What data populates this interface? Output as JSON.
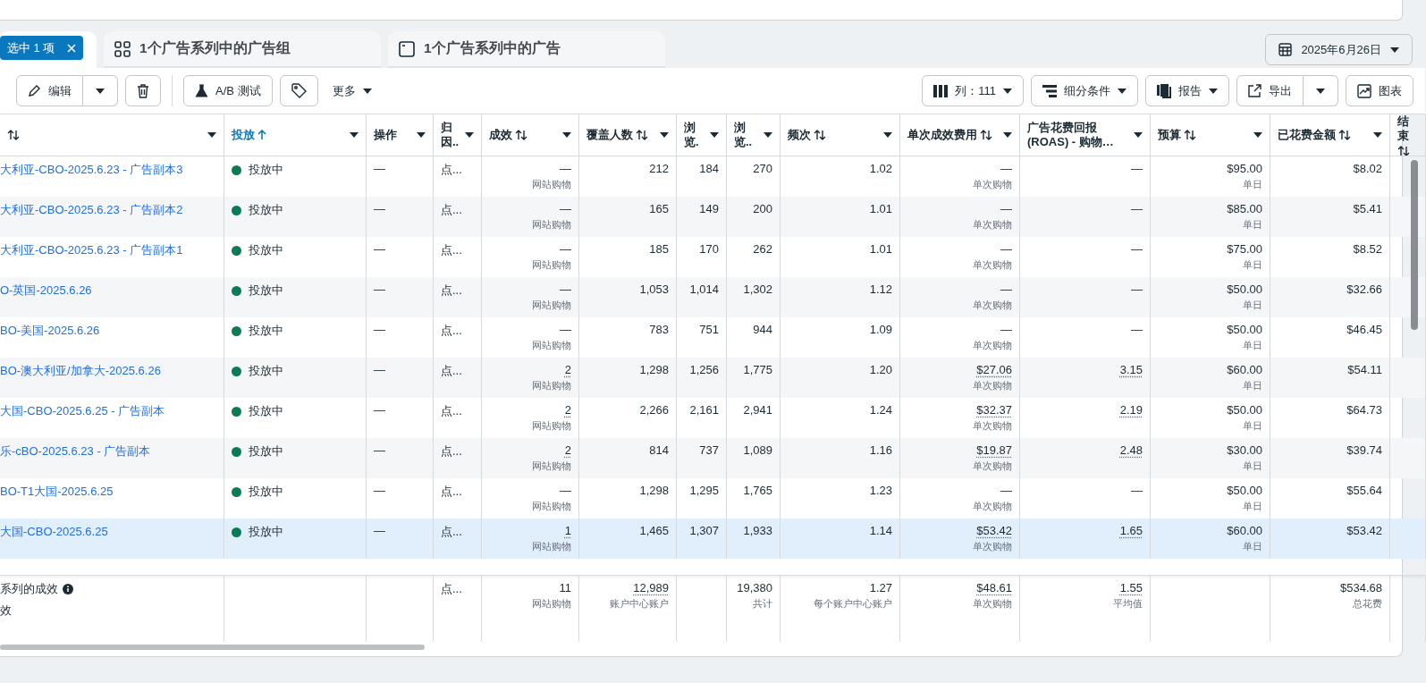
{
  "tabs": [
    {
      "kind": "selection",
      "label": "选中 1 项",
      "selected": true
    },
    {
      "kind": "adsets",
      "label": "1个广告系列中的广告组",
      "selected": false
    },
    {
      "kind": "ads",
      "label": "1个广告系列中的广告",
      "selected": false
    }
  ],
  "date_picker": {
    "label": "2025年6月26日"
  },
  "toolbar": {
    "edit": "编辑",
    "ab_test": "A/B 测试",
    "more": "更多",
    "columns": "列：111",
    "breakdown": "细分条件",
    "reports": "报告",
    "export": "导出",
    "charts": "图表"
  },
  "table": {
    "columns": [
      {
        "sortable": true,
        "selected": false
      },
      {
        "label": "投放",
        "sortable": true,
        "selected": true
      },
      {
        "label": "操作",
        "sortable": false,
        "selected": false
      },
      {
        "label": "归因..",
        "sortable": false,
        "selected": false
      },
      {
        "label": "成效",
        "sortable": true,
        "selected": false
      },
      {
        "label": "覆盖人数",
        "sortable": true,
        "selected": false
      },
      {
        "label": "浏览.",
        "sortable": false,
        "selected": false
      },
      {
        "label": "浏览..",
        "sortable": false,
        "selected": false
      },
      {
        "label": "频次",
        "sortable": true,
        "selected": false
      },
      {
        "label": "单次成效费用",
        "sortable": true,
        "selected": false
      },
      {
        "label": "广告花费回报 (ROAS) - 购物…",
        "sortable": false,
        "selected": false
      },
      {
        "label": "预算",
        "sortable": true,
        "selected": false
      },
      {
        "label": "已花费金额",
        "sortable": true,
        "selected": false
      },
      {
        "label": "结束",
        "sortable": true,
        "selected": false
      }
    ],
    "rows": [
      {
        "selected": false,
        "cells": [
          "大利亚-CBO-2025.6.23 - 广告副本3",
          "投放中",
          "—",
          "点...",
          {
            "text": "—",
            "sub": "网站购物",
            "dotted": false
          },
          "212",
          "184",
          "270",
          "1.02",
          {
            "text": "—",
            "sub": "单次购物",
            "dotted": false
          },
          "—",
          {
            "text": "$95.00",
            "sub": "单日"
          },
          "$8.02"
        ]
      },
      {
        "selected": false,
        "cells": [
          "大利亚-CBO-2025.6.23 - 广告副本2",
          "投放中",
          "—",
          "点...",
          {
            "text": "—",
            "sub": "网站购物",
            "dotted": false
          },
          "165",
          "149",
          "200",
          "1.01",
          {
            "text": "—",
            "sub": "单次购物",
            "dotted": false
          },
          "—",
          {
            "text": "$85.00",
            "sub": "单日"
          },
          "$5.41"
        ]
      },
      {
        "selected": false,
        "cells": [
          "大利亚-CBO-2025.6.23 - 广告副本1",
          "投放中",
          "—",
          "点...",
          {
            "text": "—",
            "sub": "网站购物",
            "dotted": false
          },
          "185",
          "170",
          "262",
          "1.01",
          {
            "text": "—",
            "sub": "单次购物",
            "dotted": false
          },
          "—",
          {
            "text": "$75.00",
            "sub": "单日"
          },
          "$8.52"
        ]
      },
      {
        "selected": false,
        "cells": [
          "O-英国-2025.6.26",
          "投放中",
          "—",
          "点...",
          {
            "text": "—",
            "sub": "网站购物",
            "dotted": false
          },
          "1,053",
          "1,014",
          "1,302",
          "1.12",
          {
            "text": "—",
            "sub": "单次购物",
            "dotted": false
          },
          "—",
          {
            "text": "$50.00",
            "sub": "单日"
          },
          "$32.66"
        ]
      },
      {
        "selected": false,
        "cells": [
          "BO-美国-2025.6.26",
          "投放中",
          "—",
          "点...",
          {
            "text": "—",
            "sub": "网站购物",
            "dotted": false
          },
          "783",
          "751",
          "944",
          "1.09",
          {
            "text": "—",
            "sub": "单次购物",
            "dotted": false
          },
          "—",
          {
            "text": "$50.00",
            "sub": "单日"
          },
          "$46.45"
        ]
      },
      {
        "selected": false,
        "cells": [
          "BO-澳大利亚/加拿大-2025.6.26",
          "投放中",
          "—",
          "点...",
          {
            "text": "2",
            "sub": "网站购物",
            "dotted": true
          },
          "1,298",
          "1,256",
          "1,775",
          "1.20",
          {
            "text": "$27.06",
            "sub": "单次购物",
            "dotted": true
          },
          {
            "text": "3.15",
            "dotted": true
          },
          {
            "text": "$60.00",
            "sub": "单日"
          },
          "$54.11"
        ]
      },
      {
        "selected": false,
        "cells": [
          "大国-CBO-2025.6.25 - 广告副本",
          "投放中",
          "—",
          "点...",
          {
            "text": "2",
            "sub": "网站购物",
            "dotted": true
          },
          "2,266",
          "2,161",
          "2,941",
          "1.24",
          {
            "text": "$32.37",
            "sub": "单次购物",
            "dotted": true
          },
          {
            "text": "2.19",
            "dotted": true
          },
          {
            "text": "$50.00",
            "sub": "单日"
          },
          "$64.73"
        ]
      },
      {
        "selected": false,
        "cells": [
          "乐-cBO-2025.6.23 - 广告副本",
          "投放中",
          "—",
          "点...",
          {
            "text": "2",
            "sub": "网站购物",
            "dotted": true
          },
          "814",
          "737",
          "1,089",
          "1.16",
          {
            "text": "$19.87",
            "sub": "单次购物",
            "dotted": true
          },
          {
            "text": "2.48",
            "dotted": true
          },
          {
            "text": "$30.00",
            "sub": "单日"
          },
          "$39.74"
        ]
      },
      {
        "selected": false,
        "cells": [
          "BO-T1大国-2025.6.25",
          "投放中",
          "—",
          "点...",
          {
            "text": "—",
            "sub": "网站购物",
            "dotted": false
          },
          "1,298",
          "1,295",
          "1,765",
          "1.23",
          {
            "text": "—",
            "sub": "单次购物",
            "dotted": false
          },
          "—",
          {
            "text": "$50.00",
            "sub": "单日"
          },
          "$55.64"
        ]
      },
      {
        "selected": true,
        "cells": [
          "大国-CBO-2025.6.25",
          "投放中",
          "—",
          "点...",
          {
            "text": "1",
            "sub": "网站购物",
            "dotted": true
          },
          "1,465",
          "1,307",
          "1,933",
          "1.14",
          {
            "text": "$53.42",
            "sub": "单次购物",
            "dotted": true
          },
          {
            "text": "1.65",
            "dotted": true
          },
          {
            "text": "$60.00",
            "sub": "单日"
          },
          "$53.42"
        ]
      }
    ],
    "footer": {
      "title": "系列的成效",
      "note": "效",
      "cells": [
        null,
        null,
        null,
        "点...",
        {
          "text": "11",
          "sub": "网站购物",
          "dotted": false
        },
        {
          "text": "12,989",
          "sub": "账户中心账户",
          "dotted": true
        },
        null,
        {
          "text": "19,380",
          "sub": "共计"
        },
        {
          "text": "1.27",
          "sub": "每个账户中心账户"
        },
        {
          "text": "$48.61",
          "sub": "单次购物",
          "dotted": true
        },
        {
          "text": "1.55",
          "sub": "平均值",
          "dotted": true
        },
        null,
        {
          "text": "$534.68",
          "sub": "总花费"
        }
      ]
    }
  }
}
